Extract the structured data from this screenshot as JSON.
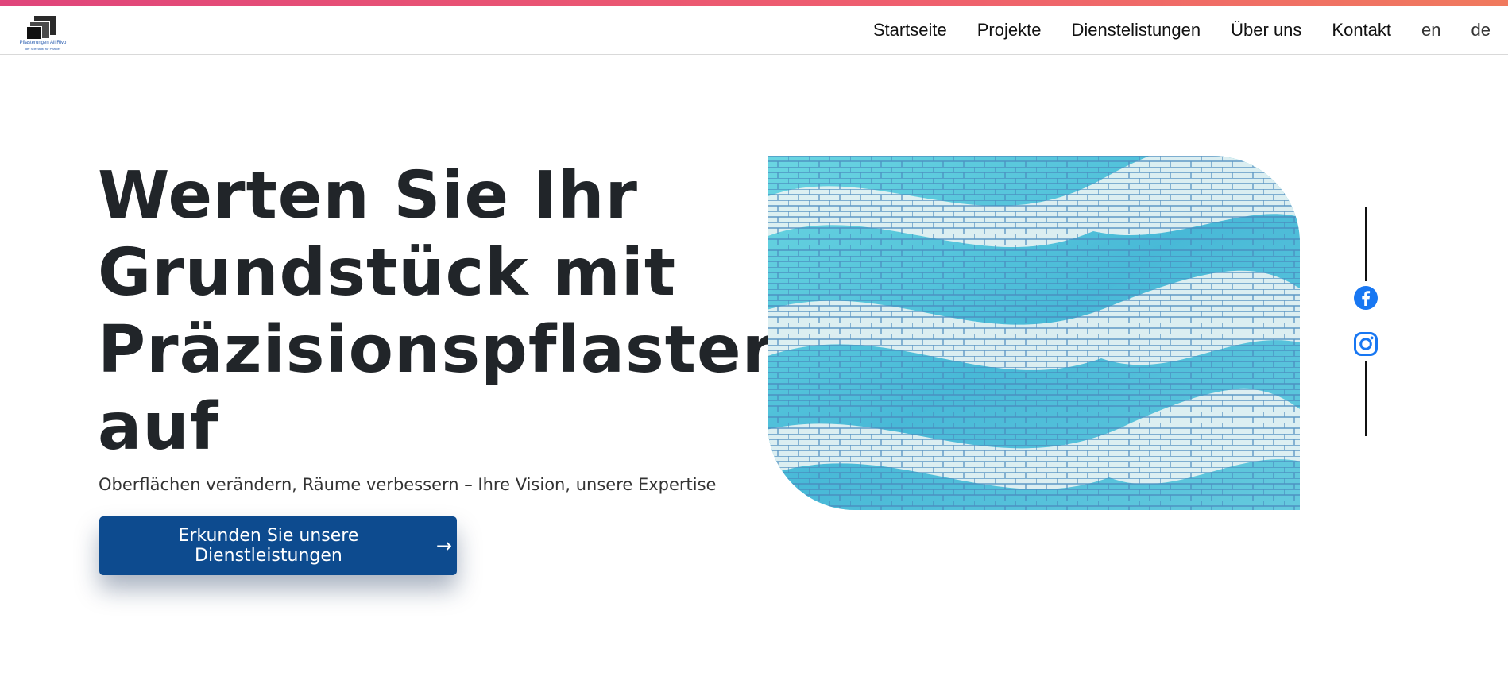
{
  "header": {
    "logo": {
      "brand_text": "Pflasterungen Ali Rivo",
      "tagline": "der Spezialist für Pflaster",
      "icon": "stacked-squares-logo"
    },
    "nav": [
      {
        "label": "Startseite"
      },
      {
        "label": "Projekte"
      },
      {
        "label": "Dienstelistungen"
      },
      {
        "label": "Über uns"
      },
      {
        "label": "Kontakt"
      },
      {
        "label": "en"
      },
      {
        "label": "de"
      }
    ],
    "accent_gradient": [
      "#e0457b",
      "#f07a5e"
    ]
  },
  "hero": {
    "title": "Werten Sie Ihr Grundstück mit Präzisionspflaster auf",
    "subtitle": "Oberflächen verändern, Räume verbessern – Ihre Vision, unsere Expertise",
    "cta_label": "Erkunden Sie unsere Dienstleistungen",
    "cta_icon": "arrow-right-icon",
    "cta_color": "#0d4b8f",
    "image_subject": "curved blue and white paving stones"
  },
  "social": [
    {
      "name": "facebook-icon",
      "color": "#1877f2"
    },
    {
      "name": "instagram-icon",
      "color": "#1877f2"
    }
  ]
}
